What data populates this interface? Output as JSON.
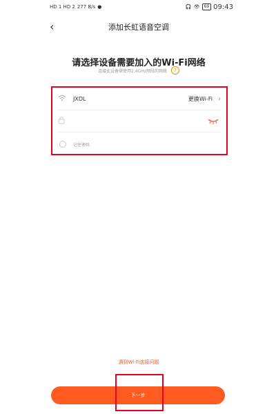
{
  "status_bar": {
    "left_text": "HD 1 HD 2",
    "speed": "277\nB/s",
    "battery": "69",
    "time": "09:43"
  },
  "header": {
    "title": "添加长虹语音空调"
  },
  "prompt": {
    "heading": "请选择设备需要加入的Wi-Fi网络",
    "subtitle": "连接此设备需使用2.4GHz频段的网络"
  },
  "form": {
    "ssid": "JXDL",
    "change_wifi": "更换Wi-Fi",
    "password_placeholder": "",
    "remember_password": "记住密码"
  },
  "footer": {
    "help_link": "遇到Wi-Fi连接问题",
    "next_button": "下一步"
  },
  "colors": {
    "accent": "#ff5a1f",
    "highlight": "#e8001c"
  },
  "icons": [
    "back-icon",
    "wifi-icon",
    "lock-icon",
    "eye-closed-icon",
    "chevron-right-icon",
    "help-icon"
  ]
}
